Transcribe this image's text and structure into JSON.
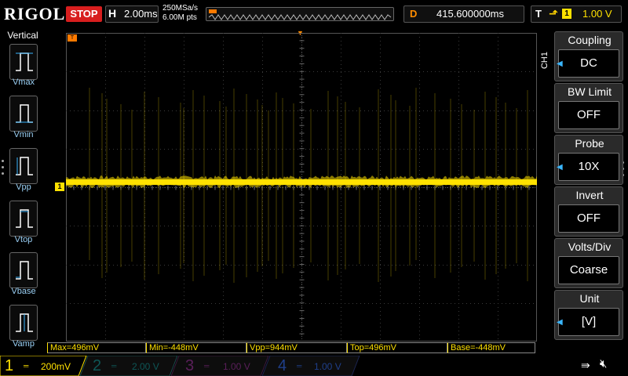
{
  "topbar": {
    "logo": "RIGOL",
    "run_status": "STOP",
    "timebase_label": "H",
    "timebase_value": "2.00ms",
    "sample_rate": "250MSa/s",
    "memory_depth": "6.00M pts",
    "delay_label": "D",
    "delay_value": "415.600000ms",
    "trigger_label": "T",
    "trigger_source": "1",
    "trigger_level": "1.00 V"
  },
  "left_panel": {
    "title": "Vertical",
    "items": [
      {
        "label": "Vmax",
        "icon": "vmax-icon"
      },
      {
        "label": "Vmin",
        "icon": "vmin-icon"
      },
      {
        "label": "Vpp",
        "icon": "vpp-icon"
      },
      {
        "label": "Vtop",
        "icon": "vtop-icon"
      },
      {
        "label": "Vbase",
        "icon": "vbase-icon"
      },
      {
        "label": "Vamp",
        "icon": "vamp-icon"
      }
    ]
  },
  "right_panel": {
    "channel_tab": "CH1",
    "items": [
      {
        "title": "Coupling",
        "value": "DC",
        "has_arrow": true
      },
      {
        "title": "BW Limit",
        "value": "OFF",
        "has_arrow": false
      },
      {
        "title": "Probe",
        "value": "10X",
        "has_arrow": true
      },
      {
        "title": "Invert",
        "value": "OFF",
        "has_arrow": false
      },
      {
        "title": "Volts/Div",
        "value": "Coarse",
        "has_arrow": false
      },
      {
        "title": "Unit",
        "value": "[V]",
        "has_arrow": true
      }
    ]
  },
  "waveform": {
    "channel_marker": "1",
    "color": "#ffe100"
  },
  "measurements": [
    {
      "label": "Max=496mV"
    },
    {
      "label": "Min=-448mV"
    },
    {
      "label": "Vpp=944mV"
    },
    {
      "label": "Top=496mV"
    },
    {
      "label": "Base=-448mV"
    }
  ],
  "bottom_channels": [
    {
      "num": "1",
      "coupling_icon": "dc-coupling-icon",
      "scale": "200mV",
      "color": "#ffe100",
      "active": true
    },
    {
      "num": "2",
      "coupling_icon": "dc-coupling-icon",
      "scale": "2.00 V",
      "color": "#00c8c8",
      "active": false
    },
    {
      "num": "3",
      "coupling_icon": "dc-coupling-icon",
      "scale": "1.00 V",
      "color": "#d040d0",
      "active": false
    },
    {
      "num": "4",
      "coupling_icon": "dc-coupling-icon",
      "scale": "1.00 V",
      "color": "#2a6bff",
      "active": false
    }
  ],
  "colors": {
    "ch1": "#ffe100",
    "trigger": "#ff7a00",
    "stop": "#d81e1e",
    "accent_blue": "#3ab6ff"
  }
}
